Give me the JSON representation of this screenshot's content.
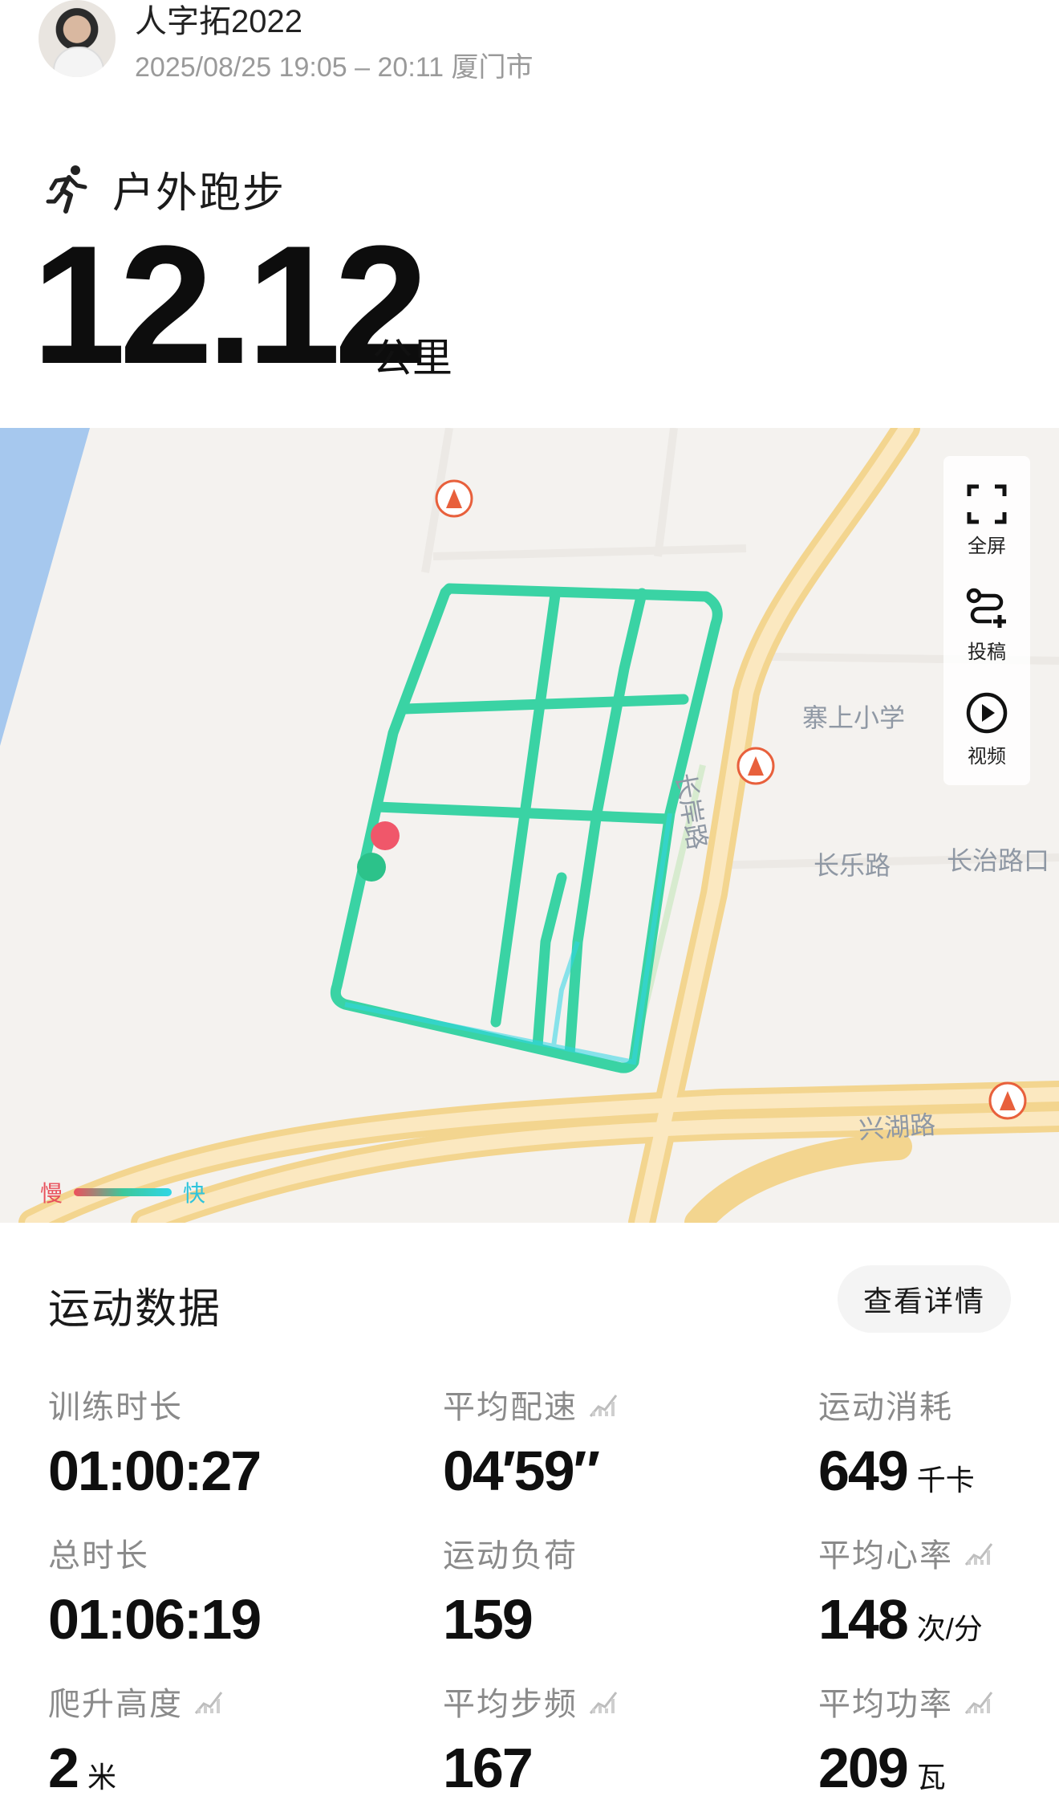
{
  "header": {
    "username": "人字拓2022",
    "subline": "2025/08/25 19:05 – 20:11 厦门市"
  },
  "activity": {
    "name": "户外跑步",
    "icon": "running-person-icon",
    "distance": "12.12",
    "distance_unit": "公里"
  },
  "map": {
    "labels": {
      "school": "寨上小学",
      "road_changle": "长乐路",
      "road_changzhi": "长治路口",
      "road_xinghu": "兴湖路",
      "road_vertical": "长岸路"
    },
    "controls": {
      "fullscreen": "全屏",
      "post": "投稿",
      "video": "视频"
    },
    "legend": {
      "slow": "慢",
      "fast": "快"
    },
    "colors": {
      "route": "#3ad3a4",
      "route_edge": "#2fd6e6",
      "start": "#2cc28a",
      "end": "#f0576a",
      "road": "#f6dca0",
      "water": "#a6c8ee",
      "construction": "#e8603c"
    }
  },
  "data_section": {
    "title": "运动数据",
    "details_button": "查看详情",
    "stats": [
      {
        "label": "训练时长",
        "value": "01:00:27",
        "unit": ""
      },
      {
        "label": "平均配速",
        "value": "04′59″",
        "unit": ""
      },
      {
        "label": "运动消耗",
        "value": "649",
        "unit": "千卡"
      },
      {
        "label": "总时长",
        "value": "01:06:19",
        "unit": ""
      },
      {
        "label": "运动负荷",
        "value": "159",
        "unit": ""
      },
      {
        "label": "平均心率",
        "value": "148",
        "unit": "次/分"
      },
      {
        "label": "爬升高度",
        "value": "2",
        "unit": "米"
      },
      {
        "label": "平均步频",
        "value": "167",
        "unit": ""
      },
      {
        "label": "平均功率",
        "value": "209",
        "unit": "瓦"
      }
    ]
  }
}
